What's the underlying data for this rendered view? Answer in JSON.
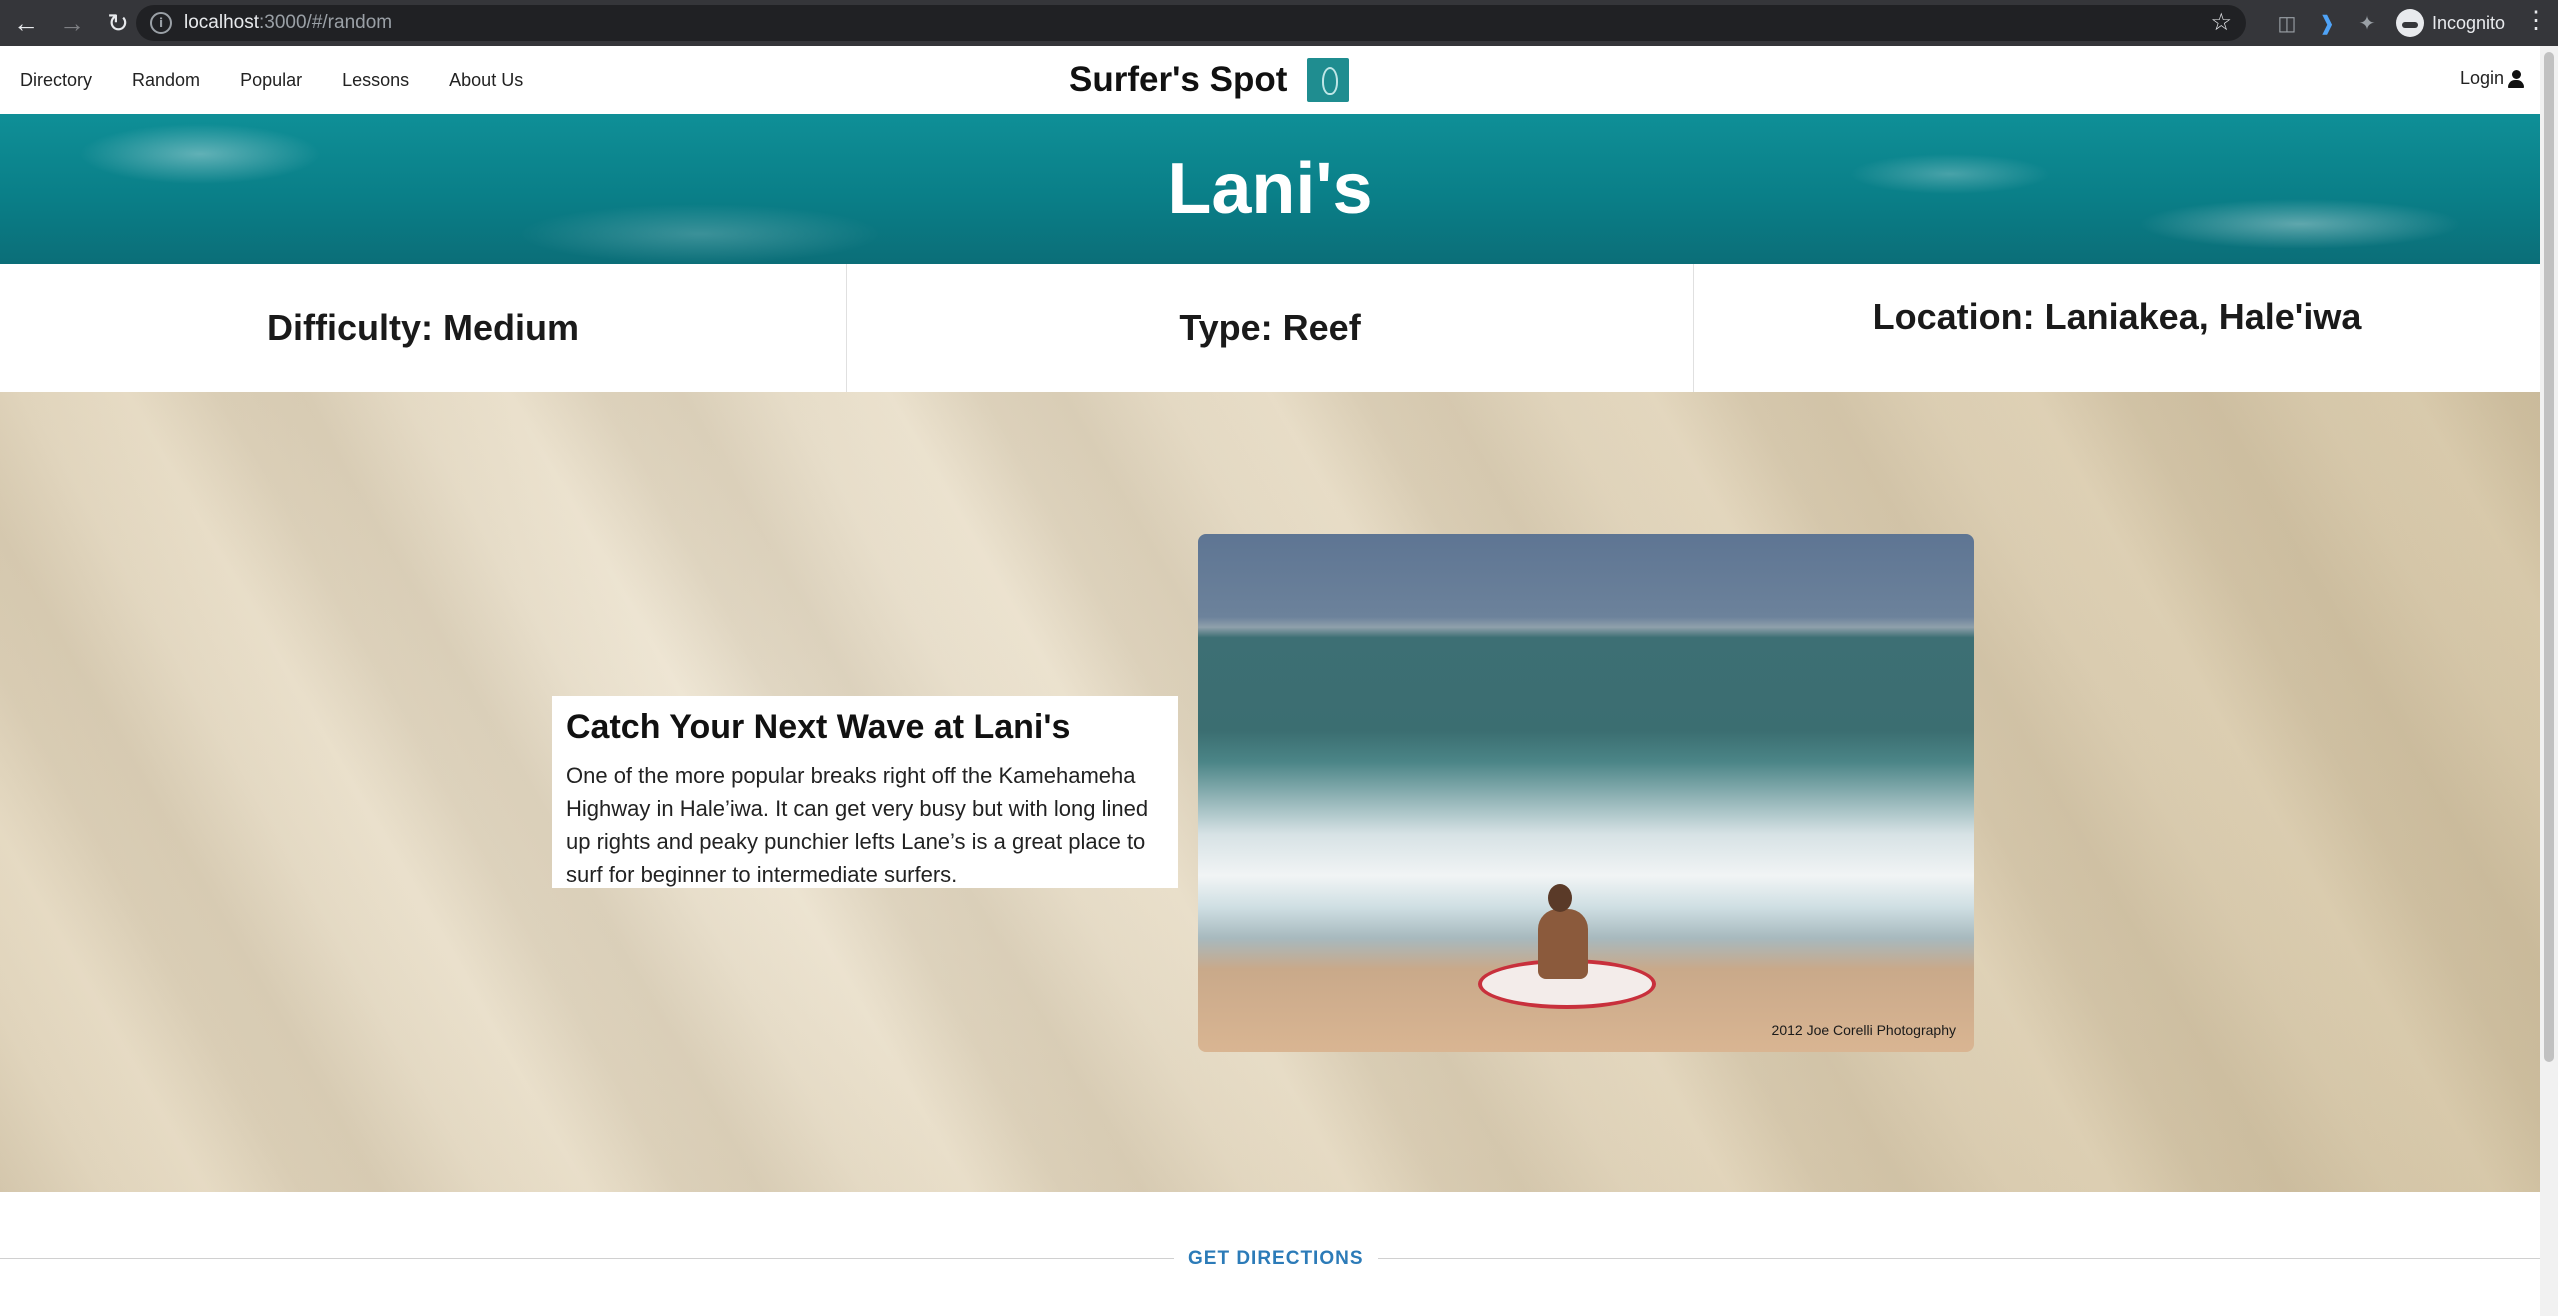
{
  "browser": {
    "url_host": "localhost",
    "url_path": ":3000/#/random",
    "profile_label": "Incognito"
  },
  "nav": {
    "items": [
      {
        "label": "Directory"
      },
      {
        "label": "Random"
      },
      {
        "label": "Popular"
      },
      {
        "label": "Lessons"
      },
      {
        "label": "About Us"
      }
    ],
    "brand": "Surfer's Spot",
    "login": "Login"
  },
  "spot": {
    "name": "Lani's",
    "difficulty": "Difficulty: Medium",
    "type": "Type: Reef",
    "location": "Location: Laniakea, Hale'iwa",
    "headline": "Catch Your Next Wave at Lani's",
    "description": "One of the more popular breaks right off the Kamehameha Highway in Hale’iwa. It can get very busy but with long lined up rights and peaky punchier lefts Lane’s is a great place to surf for beginner to intermediate surfers.",
    "photo_credit": "2012 Joe Corelli Photography"
  },
  "directions": {
    "label": "GET DIRECTIONS"
  },
  "colors": {
    "accent": "#1f8d90",
    "link": "#2c7bb8"
  }
}
